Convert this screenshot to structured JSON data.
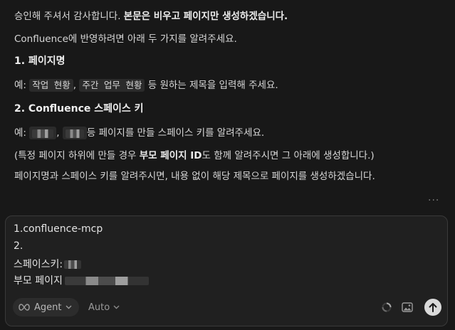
{
  "chat": {
    "line1_prefix": "승인해 주셔서 감사합니다. ",
    "line1_bold": "본문은 비우고 페이지만 생성하겠습니다.",
    "line2": "Confluence에 반영하려면 아래 두 가지를 알려주세요.",
    "heading1": "1. 페이지명",
    "ex1_prefix": "예: ",
    "ex1_code1": "작업 현황",
    "ex1_sep": ", ",
    "ex1_code2": "주간 업무 현황",
    "ex1_suffix": " 등 원하는 제목을 입력해 주세요.",
    "heading2": "2. Confluence 스페이스 키",
    "ex2_prefix": "예: ",
    "ex2_sep": ", ",
    "ex2_suffix": "등 페이지를 만들 스페이스 키를 알려주세요.",
    "note_prefix": "(특정 페이지 하위에 만들 경우 ",
    "note_bold": "부모 페이지 ID",
    "note_suffix": "도 함께 알려주시면 그 아래에 생성합니다.)",
    "closing": "페이지명과 스페이스 키를 알려주시면, 내용 없이 해당 제목으로 페이지를 생성하겠습니다.",
    "more": "···"
  },
  "composer": {
    "line1": "1.confluence-mcp",
    "line2": "2.",
    "line3": "스페이스키:",
    "line4": "부모 페이지",
    "agent_label": "Agent",
    "agent_icon": "infinity-icon",
    "mode_label": "Auto"
  }
}
